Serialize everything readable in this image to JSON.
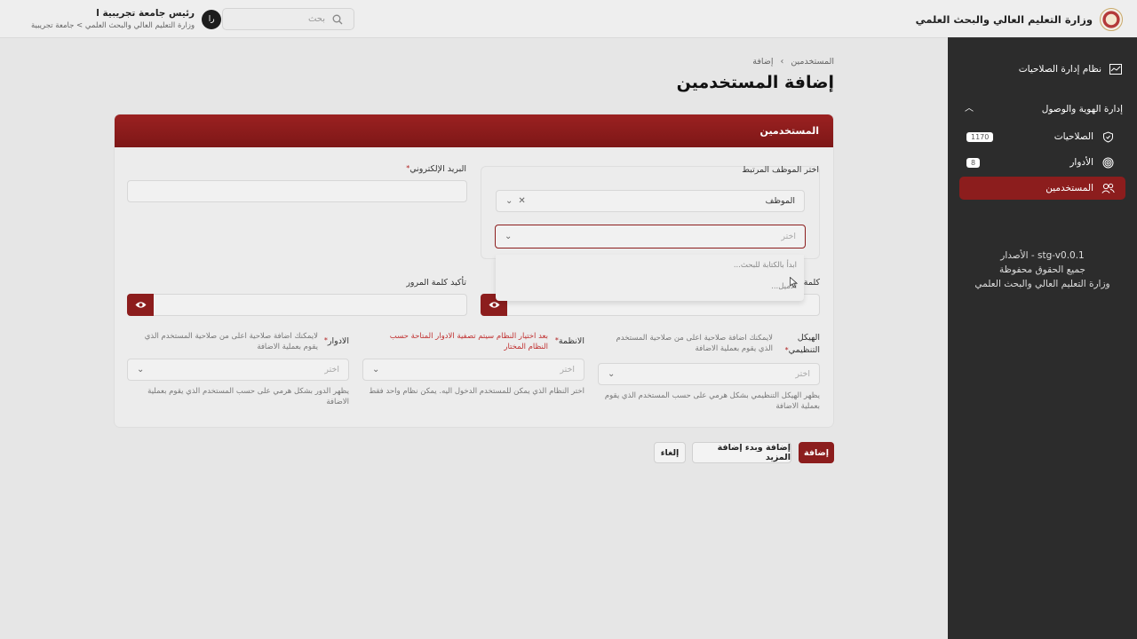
{
  "header": {
    "ministry_name": "وزارة التعليم العالي والبحث العلمي",
    "search_placeholder": "بحث",
    "user_name": "رئيس جامعة تجريبية ا",
    "user_org": "وزارة التعليم العالي والبحث العلمي > جامعة تجريبية",
    "avatar_initials": "را"
  },
  "sidebar": {
    "system_label": "نظام إدارة الصلاحيات",
    "section_label": "إدارة الهوية والوصول",
    "items": [
      {
        "label": "الصلاحيات",
        "badge": "1170"
      },
      {
        "label": "الأدوار",
        "badge": "8"
      },
      {
        "label": "المستخدمين",
        "badge": ""
      }
    ],
    "footer": {
      "version": "stg-v0.0.1 - الأصدار",
      "rights": "جميع الحقوق محفوظة",
      "org": "وزارة التعليم العالي والبحث العلمي"
    }
  },
  "breadcrumb": {
    "parent": "المستخدمين",
    "sep": "›",
    "current": "إضافة"
  },
  "page_title": "إضافة المستخدمين",
  "card": {
    "title": "المستخدمين",
    "employee_label": "اختر الموظف المرتبط",
    "employee_type_value": "الموظف",
    "employee_select_placeholder": "اختر",
    "dropdown": {
      "hint": "ابدأ بالكتابة للبحث...",
      "option": "الاميل..."
    },
    "email_label": "البريد الإلكتروني",
    "password_label": "كلمة",
    "confirm_password_label": "تأكيد كلمة المرور",
    "org_structure": {
      "label": "الهيكل التنظيمي",
      "note": "لايمكنك اضافة صلاحية اعلى من صلاحية المستخدم الذي يقوم بعملية الاضافة",
      "placeholder": "اختر",
      "hint": "يظهر الهيكل التنظيمي بشكل هرمي على حسب المستخدم الذي يقوم بعملية الاضافة"
    },
    "systems": {
      "label": "الانظمة",
      "note": "بعد اختيار النظام سيتم تصفية الادوار المتاحة حسب النظام المختار",
      "placeholder": "اختر",
      "hint": "اختر النظام الذي يمكن للمستخدم الدخول اليه. يمكن نظام واحد فقط"
    },
    "roles": {
      "label": "الادوار",
      "note": "لايمكنك اضافة صلاحية اعلى من صلاحية المستخدم الذي يقوم بعملية الاضافة",
      "placeholder": "اختر",
      "hint": "يظهر الدور بشكل هرمي على حسب المستخدم الذي يقوم بعملية الاضافة"
    }
  },
  "actions": {
    "add": "إضافة",
    "add_more": "إضافة وبدء إضافة المزيد",
    "cancel": "إلغاء"
  }
}
